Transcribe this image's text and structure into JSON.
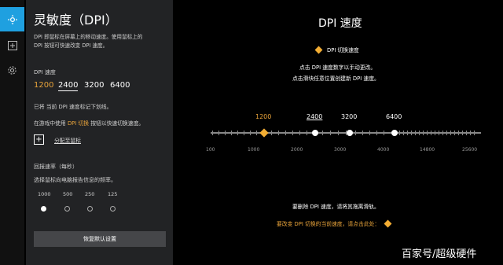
{
  "rail": {
    "items": [
      "move-icon",
      "add-icon",
      "settings-icon"
    ]
  },
  "panel": {
    "title": "灵敏度（DPI）",
    "desc_line1": "DPI 即鼠标在屏幕上的移动速度。使用鼠标上的",
    "desc_line2": "DPI 按钮可快速改变 DPI 速度。",
    "dpi_label": "DPI 速度",
    "dpi_options": [
      "1200",
      "2400",
      "3200",
      "6400"
    ],
    "note_marked": "已将 当前 DPI 速度标记下划线。",
    "note_switch_pre": "在游戏中使用",
    "note_switch_hl": "DPI 切换",
    "note_switch_post": "按钮以快速切换速度。",
    "assign_label": "分配至鼠标",
    "rate_label": "回报速率（每秒）",
    "rate_desc": "选择鼠标向电脑报告信息的频率。",
    "rate_options": [
      "1000",
      "500",
      "250",
      "125"
    ],
    "reset_label": "恢复默认设置"
  },
  "main": {
    "title": "DPI 速度",
    "tag": "DPI 切换速度",
    "hint1": "点击 DPI 速度数字以手动更改。",
    "hint2": "点击滑块任意位置创建新 DPI 速度。",
    "stops": [
      "1200",
      "2400",
      "3200",
      "6400"
    ],
    "scale": [
      "100",
      "1000",
      "2000",
      "3000",
      "4000",
      "14800",
      "25600"
    ],
    "remove_hint": "要删除 DPI 速度，请将其拖离滑轨。",
    "change_hint": "要改变 DPI 切换的当前速度，请点击此处："
  },
  "watermark": "百家号/超级硬件",
  "colors": {
    "accent": "#f3ad33",
    "rail_active": "#1fa0e0",
    "panel_bg": "#222325"
  }
}
